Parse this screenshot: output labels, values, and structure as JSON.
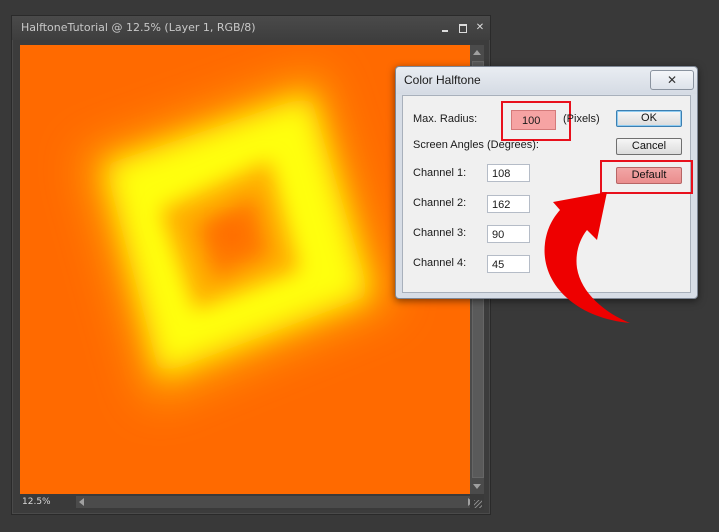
{
  "document_window": {
    "title": "HalftoneTutorial @ 12.5% (Layer 1, RGB/8)",
    "close_glyph": "✕",
    "zoom_level": "12.5%"
  },
  "canvas": {
    "background_color": "#ff6a00",
    "highlight_color": "#ffff00"
  },
  "dialog": {
    "title": "Color Halftone",
    "close_glyph": "✕",
    "max_radius_label": "Max. Radius:",
    "max_radius_value": "100",
    "max_radius_unit": "(Pixels)",
    "screen_angles_label": "Screen Angles (Degrees):",
    "channels": [
      {
        "label": "Channel 1:",
        "value": "108"
      },
      {
        "label": "Channel 2:",
        "value": "162"
      },
      {
        "label": "Channel 3:",
        "value": "90"
      },
      {
        "label": "Channel 4:",
        "value": "45"
      }
    ],
    "buttons": {
      "ok": "OK",
      "cancel": "Cancel",
      "default": "Default"
    }
  },
  "annotation": {
    "highlight_color": "#e8101c",
    "arrow_color": "#ee0000"
  }
}
